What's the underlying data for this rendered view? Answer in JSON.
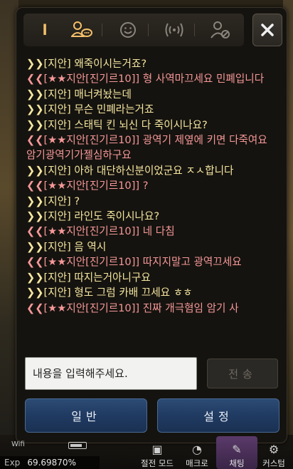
{
  "tabs": [
    {
      "name": "all",
      "label": "l"
    },
    {
      "name": "guild",
      "label": ""
    },
    {
      "name": "emoji",
      "label": ""
    },
    {
      "name": "broadcast",
      "label": ""
    },
    {
      "name": "block",
      "label": ""
    }
  ],
  "messages": [
    {
      "from": "self",
      "text": "❯❯[지안] 왜죽이시는거죠?"
    },
    {
      "from": "other",
      "text": "❮❮[★★지안[진기르10]] 형 사역마끄세요 민폐입니다"
    },
    {
      "from": "self",
      "text": "❯❯[지안] 매너켜놨는데"
    },
    {
      "from": "self",
      "text": "❯❯[지안] 무슨 민폐라는거죠"
    },
    {
      "from": "self",
      "text": "❯❯[지안] 스태틱 킨 뇌신 다 죽이시나요?"
    },
    {
      "from": "other",
      "text": "❮❮[★★지안[진기르10]] 광역기 제옆에 키면 다죽여요 암기광역기가젤심하구요"
    },
    {
      "from": "self",
      "text": "❯❯[지안] 아하 대단하신분이었군요 ㅈㅅ합니다"
    },
    {
      "from": "other",
      "text": "❮❮[★★지안[진기르10]] ?"
    },
    {
      "from": "self",
      "text": "❯❯[지안] ?"
    },
    {
      "from": "self",
      "text": "❯❯[지안] 라인도 죽이시나요?"
    },
    {
      "from": "other",
      "text": "❮❮[★★지안[진기르10]] 네 다침"
    },
    {
      "from": "self",
      "text": "❯❯[지안] 음 역시"
    },
    {
      "from": "other",
      "text": "❮❮[★★지안[진기르10]] 따지지말고 광역끄세요"
    },
    {
      "from": "self",
      "text": "❯❯[지안] 따지는거아니구요"
    },
    {
      "from": "self",
      "text": "❯❯[지안] 형도 그럼 카배 끄세요 ㅎㅎ"
    },
    {
      "from": "other",
      "text": "❮❮[★★지안[진기르10]] 진짜 개극혐임 암기 사"
    }
  ],
  "input": {
    "placeholder": "내용을 입력해주세요."
  },
  "send_label": "전송",
  "buttons": {
    "general": "일반",
    "settings": "설정"
  },
  "hud": {
    "wifi": "Wifi",
    "exp_label": "Exp",
    "exp_value": "69.69870%",
    "icons": [
      {
        "label": "절전 모드",
        "glyph": "▣"
      },
      {
        "label": "매크로",
        "glyph": "◔"
      },
      {
        "label": "채팅",
        "glyph": "✎"
      },
      {
        "label": "커스텀",
        "glyph": "⚙"
      }
    ]
  },
  "colors": {
    "self_msg": "#f5e6a0",
    "other_msg": "#f59898",
    "button_blue": "#1f3960"
  }
}
